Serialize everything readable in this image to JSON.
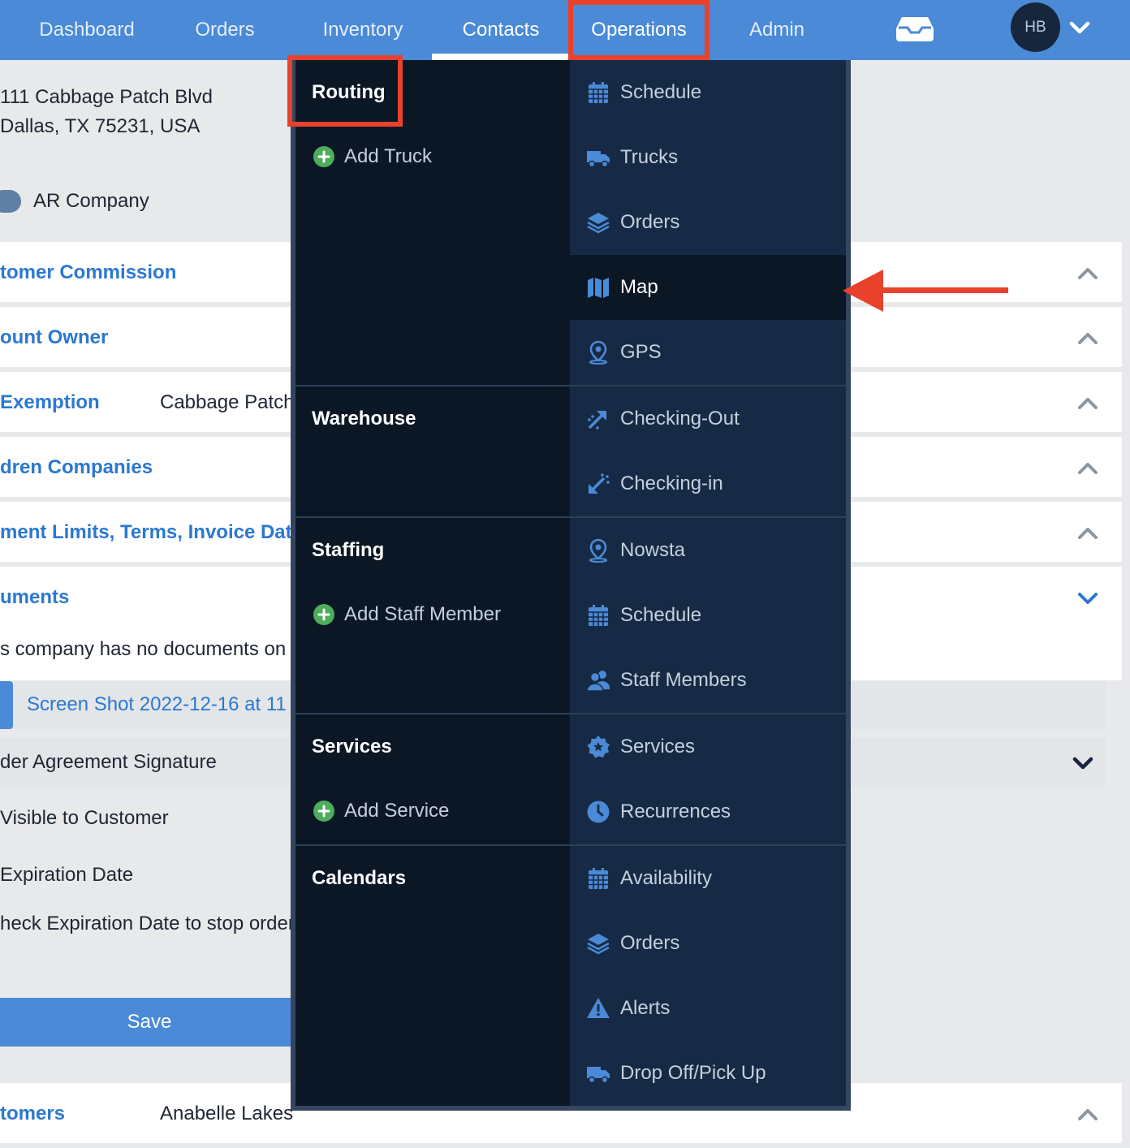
{
  "nav": {
    "items": [
      {
        "label": "Dashboard"
      },
      {
        "label": "Orders"
      },
      {
        "label": "Inventory"
      },
      {
        "label": "Contacts"
      },
      {
        "label": "Operations"
      },
      {
        "label": "Admin"
      }
    ],
    "active": "Contacts",
    "avatar_initials": "HB"
  },
  "page": {
    "address_line1": "111 Cabbage Patch Blvd",
    "address_line2": "Dallas, TX 75231, USA",
    "toggle_label": "AR Company",
    "sections": [
      {
        "title": "tomer Commission",
        "value": ""
      },
      {
        "title": "ount Owner",
        "value": ""
      },
      {
        "title": "Exemption",
        "value": "Cabbage Patch"
      },
      {
        "title": "dren Companies",
        "value": ""
      },
      {
        "title": "ment Limits, Terms, Invoice Dates",
        "value": ""
      },
      {
        "title": "uments",
        "value": ""
      }
    ],
    "doc_note": "s company has no documents on f",
    "file_link": "Screen Shot 2022-12-16 at 11",
    "signature_label": "der Agreement Signature",
    "visible_label": "Visible to Customer",
    "expiration_label": "Expiration Date",
    "check_expiration_label": "heck Expiration Date to stop order",
    "save_label": "Save",
    "customers_section": {
      "title": "tomers",
      "value": "Anabelle Lakes"
    }
  },
  "dropdown": {
    "groups": [
      {
        "title": "Routing",
        "add_label": "Add Truck"
      },
      {
        "title": "Warehouse",
        "add_label": ""
      },
      {
        "title": "Staffing",
        "add_label": "Add Staff Member"
      },
      {
        "title": "Services",
        "add_label": "Add Service"
      },
      {
        "title": "Calendars",
        "add_label": ""
      }
    ],
    "items": [
      {
        "label": "Schedule",
        "icon": "calendar-icon"
      },
      {
        "label": "Trucks",
        "icon": "truck-icon"
      },
      {
        "label": "Orders",
        "icon": "layers-icon"
      },
      {
        "label": "Map",
        "icon": "map-icon",
        "active": true
      },
      {
        "label": "GPS",
        "icon": "map-pin-icon"
      },
      {
        "label": "Checking-Out",
        "icon": "arrow-out-icon"
      },
      {
        "label": "Checking-in",
        "icon": "arrow-in-icon"
      },
      {
        "label": "Nowsta",
        "icon": "map-pin-icon"
      },
      {
        "label": "Schedule",
        "icon": "calendar-icon"
      },
      {
        "label": "Staff Members",
        "icon": "users-icon"
      },
      {
        "label": "Services",
        "icon": "badge-star-icon"
      },
      {
        "label": "Recurrences",
        "icon": "clock-icon"
      },
      {
        "label": "Availability",
        "icon": "calendar-icon"
      },
      {
        "label": "Orders",
        "icon": "layers-icon"
      },
      {
        "label": "Alerts",
        "icon": "warning-icon"
      },
      {
        "label": "Drop Off/Pick Up",
        "icon": "truck-icon"
      }
    ]
  },
  "annotations": {
    "highlight_color": "#e8412c",
    "highlighted": [
      "Operations",
      "Routing"
    ],
    "arrow_target": "Map"
  },
  "colors": {
    "nav_bg": "#4a8ad6",
    "dropdown_left_bg": "#0c1726",
    "dropdown_right_bg": "#172a45",
    "link": "#2b78d1",
    "icon": "#4a8ad6",
    "add_icon": "#4cae5b"
  }
}
